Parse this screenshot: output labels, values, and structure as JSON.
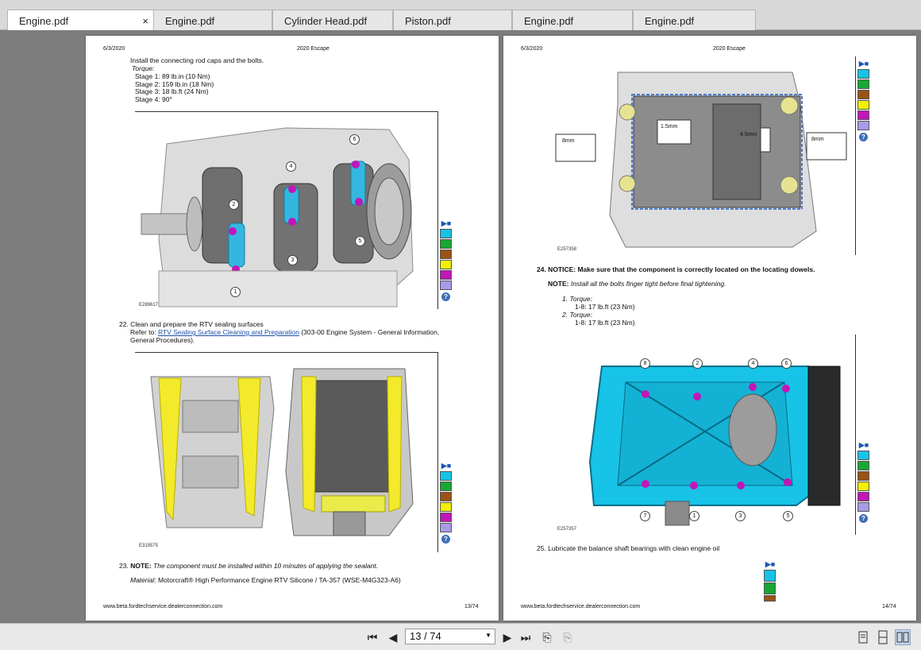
{
  "tabs": [
    {
      "label": "Engine.pdf",
      "active": true,
      "close": "×"
    },
    {
      "label": "Engine.pdf"
    },
    {
      "label": "Cylinder Head.pdf"
    },
    {
      "label": "Piston.pdf"
    },
    {
      "label": "Engine.pdf"
    },
    {
      "label": "Engine.pdf"
    }
  ],
  "left_page": {
    "date": "6/3/2020",
    "title": "2020 Escape",
    "step21": {
      "text": "Install the connecting rod caps and the bolts.",
      "torque_label": "Torque:",
      "stages": [
        "Stage 1:  89 lb.in (10 Nm)",
        "Stage 2:  159 lb.in (18 Nm)",
        "Stage 3:  18 lb.ft (24 Nm)",
        "Stage 4:  90°"
      ]
    },
    "fig1_id": "E289617",
    "fig1_callouts": [
      "1",
      "2",
      "3",
      "4",
      "5",
      "6"
    ],
    "step22": {
      "text": "22. Clean and prepare the RTV sealing surfaces",
      "refer": "Refer to:",
      "link": "RTV Sealing Surface Cleaning and Preparation",
      "rest1": "(303-00 Engine System - General Information,",
      "rest2": "General Procedures)."
    },
    "fig2_id": "E319575",
    "step23": {
      "num": "23.",
      "note": "NOTE:",
      "note_text": "The component must be installed within 10 minutes of applying the sealant.",
      "material_label": "Material",
      "material_text": ": Motorcraft® High Performance Engine RTV Silicone / TA-357 (WSE-M4G323-A6)"
    },
    "footer_url": "www.beta.fordtechservice.dealerconnection.com",
    "footer_page": "13/74"
  },
  "right_page": {
    "date": "6/3/2020",
    "title": "2020 Escape",
    "fig3_id": "E257358",
    "fig3_labels": [
      "8mm",
      "1.5mm",
      "4.5mm",
      "8mm"
    ],
    "step24": {
      "text": "24. NOTICE: Make sure that the component is correctly located on the locating dowels.",
      "note": "NOTE:",
      "note_text": "Install all the bolts finger tight before final tightening.",
      "torque1_label": "1.  Torque:",
      "torque1": "1-8:   17 lb.ft (23 Nm)",
      "torque2_label": "2.  Torque:",
      "torque2": "1-8:   17 lb.ft (23 Nm)"
    },
    "fig4_id": "E257357",
    "fig4_callouts": [
      "8",
      "2",
      "4",
      "6",
      "7",
      "1",
      "3",
      "5"
    ],
    "step25": "25. Lubricate the balance shaft bearings with clean engine oil",
    "footer_url": "www.beta.fordtechservice.dealerconnection.com",
    "footer_page": "14/74"
  },
  "legend_colors": [
    "#17c3e6",
    "#16a832",
    "#9a5316",
    "#f2f000",
    "#c216b8",
    "#a89be8"
  ],
  "toolbar": {
    "page_value": "13 / 74"
  }
}
